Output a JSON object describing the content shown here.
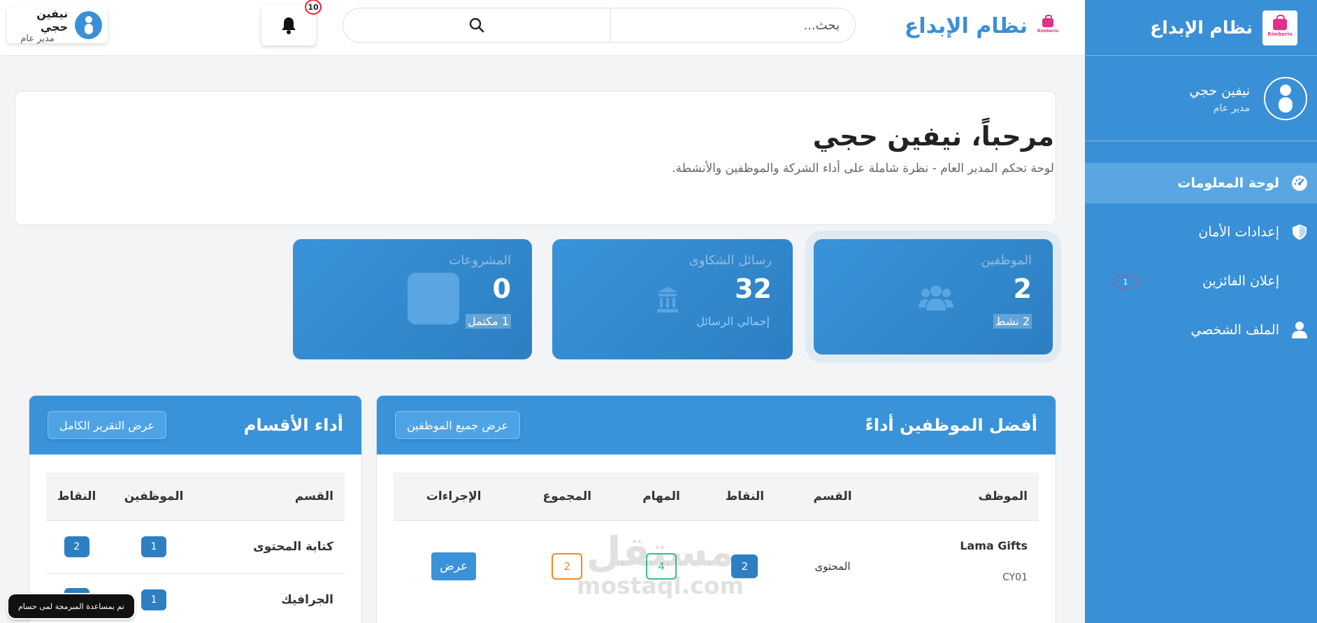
{
  "sidebar": {
    "brand_name": "نظام الإبداع",
    "logo_text": "Rimberio",
    "user_name": "نيفين حجي",
    "user_role": "مدير عام",
    "nav": [
      {
        "label": "لوحة المعلومات",
        "icon": "dashboard-gauge-icon",
        "active": true
      },
      {
        "label": "إعدادات الأمان",
        "icon": "shield-icon"
      },
      {
        "label": "إعلان الفائزين",
        "badge": "1"
      },
      {
        "label": "الملف الشخصي",
        "icon": "user-icon"
      }
    ]
  },
  "header": {
    "brand_name": "نظام الإبداع",
    "logo_text": "Rimberio",
    "search_placeholder": "بحث...",
    "notification_count": "10",
    "user_name": "نيفين حجي",
    "user_role": "مدير عام"
  },
  "welcome": {
    "title": "مرحباً، نيفين حجي",
    "subtitle": "لوحة تحكم المدير العام - نظرة شاملة على أداء الشركة والموظفين والأنشطة."
  },
  "stats": [
    {
      "label": "الموظفين",
      "value": "2",
      "sub": "2 نشط",
      "icon": "users-icon"
    },
    {
      "label": "رسائل الشكاوى",
      "value": "32",
      "sub": "إجمالي الرسائل",
      "icon": "building-icon"
    },
    {
      "label": "المشروعات",
      "value": "0",
      "sub": "1 مكتمل",
      "icon": "square-icon"
    }
  ],
  "top_employees": {
    "title": "أفضل الموظفين أداءً",
    "button": "عرض جميع الموظفين",
    "columns": [
      "الموظف",
      "القسم",
      "النقاط",
      "المهام",
      "المجموع",
      "الإجراءات"
    ],
    "rows": [
      {
        "name": "Lama Gifts",
        "code": "CY01",
        "department": "المحتوى",
        "points": "2",
        "tasks": "4",
        "total": "2",
        "action": "عرض"
      }
    ]
  },
  "departments": {
    "title": "أداء الأقسام",
    "button": "عرض التقرير الكامل",
    "columns": [
      "القسم",
      "الموظفين",
      "النقاط"
    ],
    "rows": [
      {
        "name": "كتابة المحتوى",
        "employees": "1",
        "points": "2"
      },
      {
        "name": "الجرافيك",
        "employees": "1",
        "points": ""
      }
    ]
  },
  "watermark": {
    "line1": "مستقل",
    "line2": "mostaql.com"
  },
  "toast": "تم بمساعدة المبرمجة لمى حسام",
  "colors": {
    "primary": "#3a90d6",
    "accent_pink": "#e0328a",
    "green": "#34c28b",
    "orange": "#f08a1e"
  }
}
